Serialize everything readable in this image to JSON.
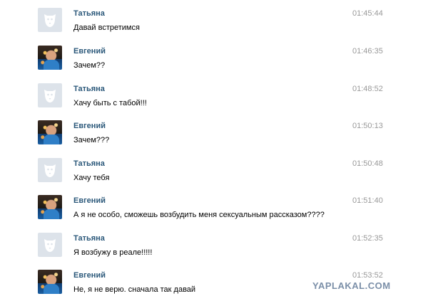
{
  "messages": [
    {
      "name": "Татьяна",
      "time": "01:45:44",
      "text": "Давай встретимся",
      "avatar": "default-dog-icon"
    },
    {
      "name": "Евгений",
      "time": "01:46:35",
      "text": "Зачем??",
      "avatar": "user-photo"
    },
    {
      "name": "Татьяна",
      "time": "01:48:52",
      "text": "Хачу быть с табой!!!",
      "avatar": "default-dog-icon"
    },
    {
      "name": "Евгений",
      "time": "01:50:13",
      "text": "Зачем???",
      "avatar": "user-photo"
    },
    {
      "name": "Татьяна",
      "time": "01:50:48",
      "text": "Хачу тебя",
      "avatar": "default-dog-icon"
    },
    {
      "name": "Евгений",
      "time": "01:51:40",
      "text": "А я не особо, сможешь возбудить меня сексуальным рассказом????",
      "avatar": "user-photo"
    },
    {
      "name": "Татьяна",
      "time": "01:52:35",
      "text": "Я возбужу в реале!!!!!",
      "avatar": "default-dog-icon"
    },
    {
      "name": "Евгений",
      "time": "01:53:52",
      "text": "Не, я не верю. сначала так давай",
      "avatar": "user-photo"
    }
  ],
  "watermark": "YAPLAKAL.COM",
  "colors": {
    "name": "#2b587a",
    "time": "#999999",
    "text": "#000000",
    "watermark": "#7b8fa8"
  }
}
